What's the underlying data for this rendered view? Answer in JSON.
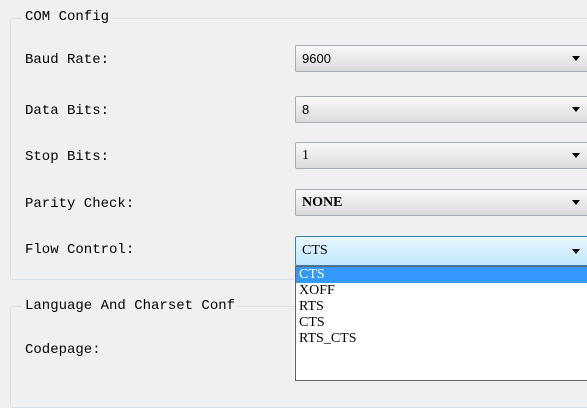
{
  "com_config": {
    "title": "COM Config",
    "fields": [
      {
        "label": "Baud Rate:",
        "value": "9600"
      },
      {
        "label": "Data Bits:",
        "value": "8"
      },
      {
        "label": "Stop Bits:",
        "value": "1"
      },
      {
        "label": "Parity Check:",
        "value": "NONE"
      },
      {
        "label": "Flow Control:",
        "value": "CTS"
      }
    ]
  },
  "flow_control_options": [
    "CTS",
    "XOFF",
    "RTS",
    "CTS",
    "RTS_CTS"
  ],
  "language_config": {
    "title": "Language And Charset Conf",
    "codepage_label": "Codepage:"
  }
}
